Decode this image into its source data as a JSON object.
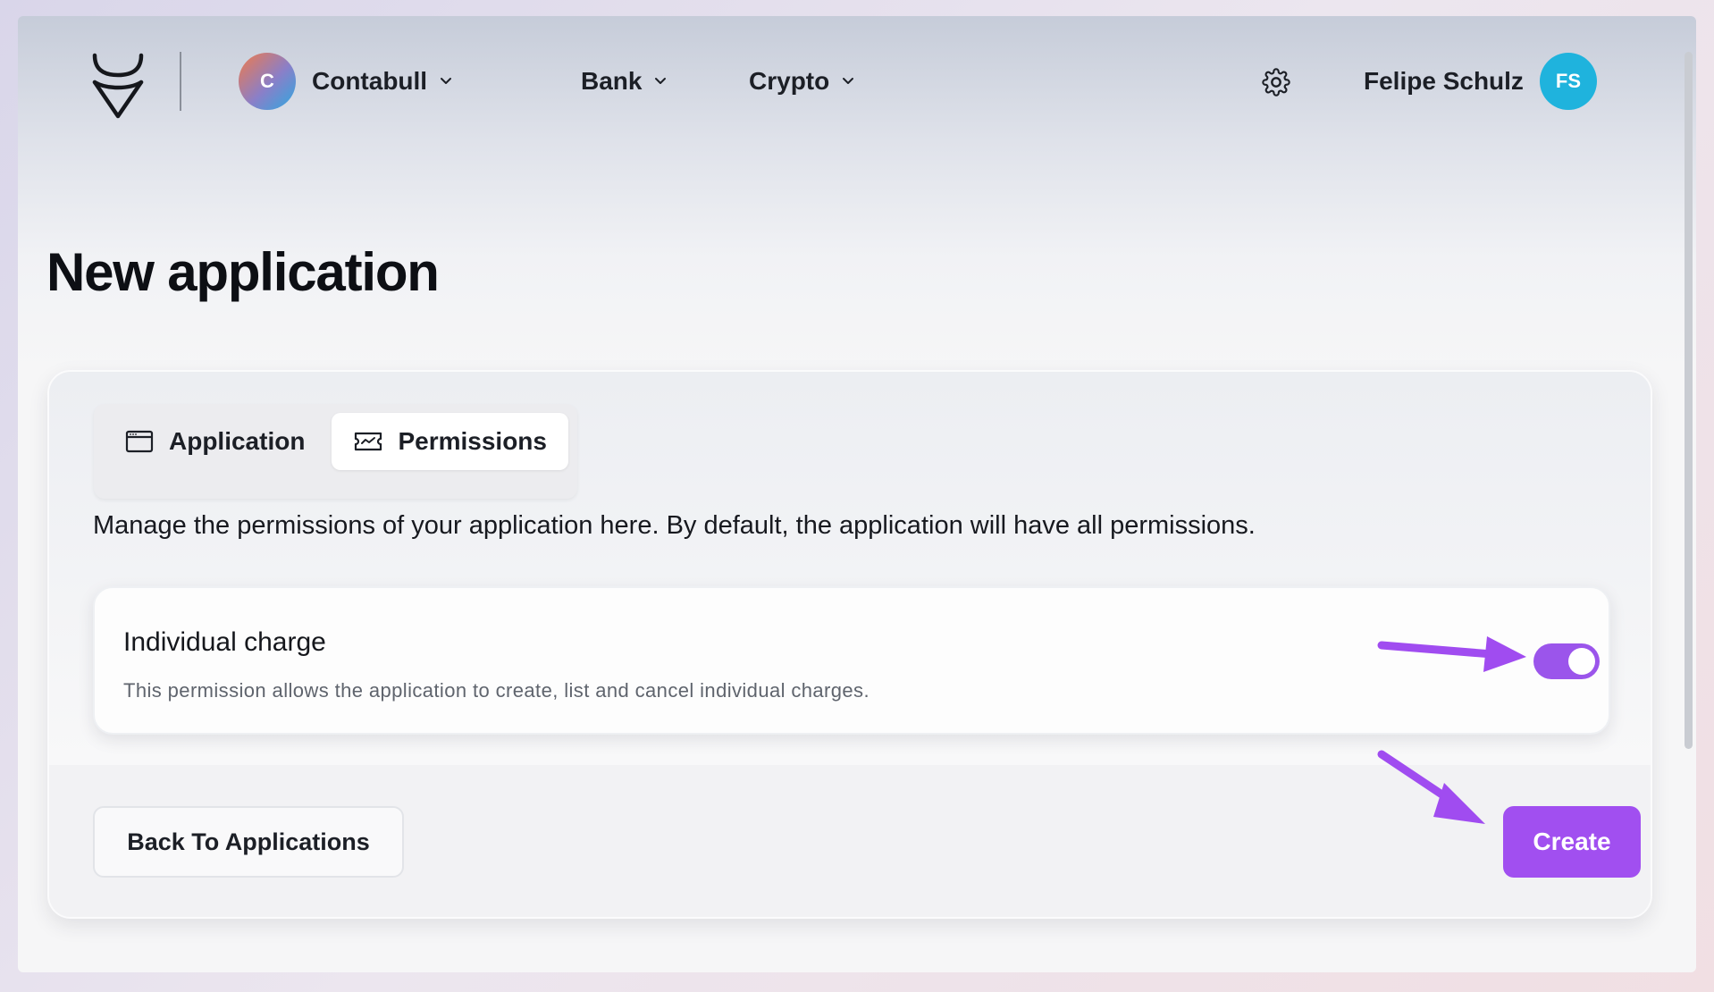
{
  "header": {
    "company": {
      "initial": "C",
      "name": "Contabull"
    },
    "nav": [
      {
        "label": "Bank"
      },
      {
        "label": "Crypto"
      }
    ],
    "user": {
      "name": "Felipe Schulz",
      "initials": "FS"
    }
  },
  "page": {
    "title": "New application"
  },
  "tabs": [
    {
      "label": "Application",
      "icon": "window-icon",
      "active": false
    },
    {
      "label": "Permissions",
      "icon": "ticket-icon",
      "active": true
    }
  ],
  "permissions": {
    "description": "Manage the permissions of your application here. By default, the application will have all permissions.",
    "items": [
      {
        "title": "Individual charge",
        "description": "This permission allows the application to create, list and cancel individual charges.",
        "enabled": true
      }
    ]
  },
  "actions": {
    "back_label": "Back To Applications",
    "create_label": "Create"
  },
  "colors": {
    "accent": "#a14ff0",
    "toggle_on": "#9b55eb",
    "user_avatar": "#1fb3dd",
    "annotation_arrow": "#a04cf0"
  }
}
